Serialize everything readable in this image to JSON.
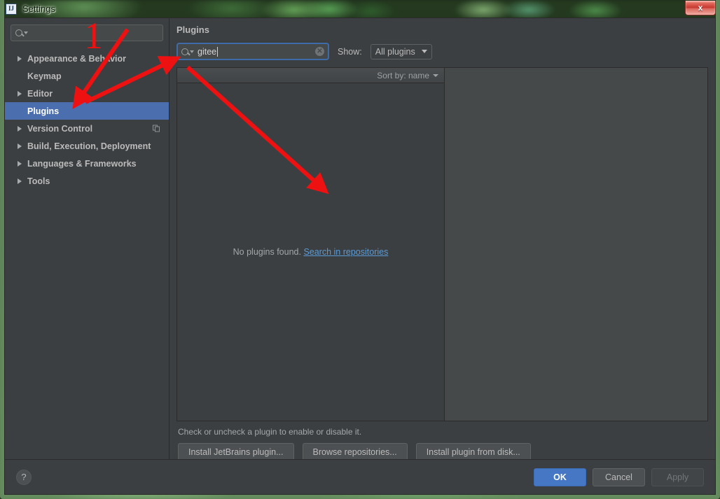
{
  "window": {
    "title": "Settings",
    "app_icon": "intellij-idea-icon",
    "close_label": "x"
  },
  "sidebar": {
    "search": {
      "value": "",
      "placeholder": "",
      "icon": "search-icon"
    },
    "items": [
      {
        "label": "Appearance & Behavior",
        "expandable": true,
        "selected": false,
        "badge": false
      },
      {
        "label": "Keymap",
        "expandable": false,
        "selected": false,
        "badge": false
      },
      {
        "label": "Editor",
        "expandable": true,
        "selected": false,
        "badge": false
      },
      {
        "label": "Plugins",
        "expandable": false,
        "selected": true,
        "badge": false
      },
      {
        "label": "Version Control",
        "expandable": true,
        "selected": false,
        "badge": true
      },
      {
        "label": "Build, Execution, Deployment",
        "expandable": true,
        "selected": false,
        "badge": false
      },
      {
        "label": "Languages & Frameworks",
        "expandable": true,
        "selected": false,
        "badge": false
      },
      {
        "label": "Tools",
        "expandable": true,
        "selected": false,
        "badge": false
      }
    ]
  },
  "content": {
    "title": "Plugins",
    "plugin_search": {
      "value": "gitee",
      "icon": "search-icon",
      "clear_icon": "clear-circle-icon"
    },
    "show_label": "Show:",
    "show_value": "All plugins",
    "sort_label": "Sort by: name",
    "empty_text": "No plugins found.",
    "empty_link": "Search in repositories",
    "hint": "Check or uncheck a plugin to enable or disable it.",
    "buttons": [
      {
        "label": "Install JetBrains plugin..."
      },
      {
        "label": "Browse repositories..."
      },
      {
        "label": "Install plugin from disk..."
      }
    ]
  },
  "footer": {
    "help_label": "?",
    "ok": "OK",
    "cancel": "Cancel",
    "apply": "Apply"
  },
  "annotations": {
    "step_number": "1",
    "accent_color": "#ee1111"
  }
}
